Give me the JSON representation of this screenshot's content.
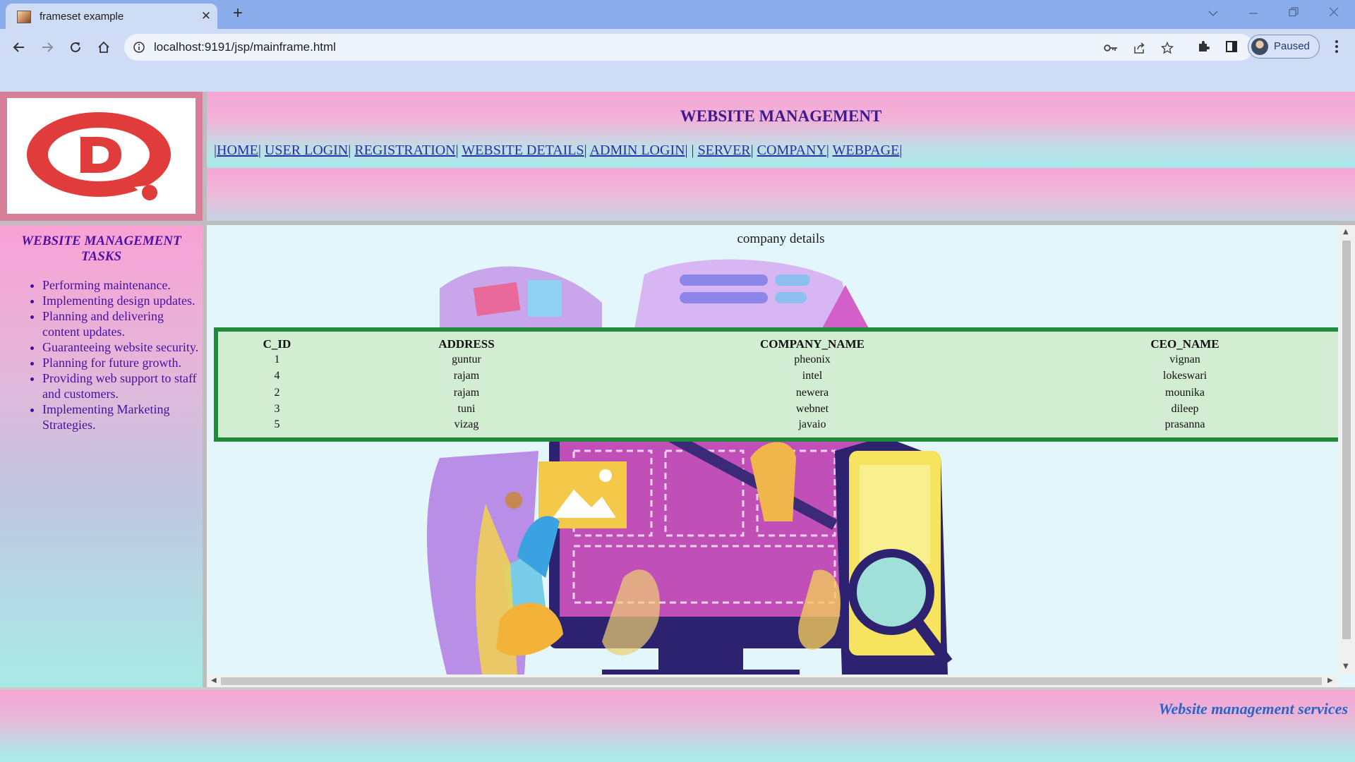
{
  "browser": {
    "tab_title": "frameset example",
    "new_tab_symbol": "+",
    "close_symbol": "✕",
    "url": "localhost:9191/jsp/mainframe.html",
    "profile_label": "Paused",
    "icons": [
      "back-icon",
      "forward-icon",
      "reload-icon",
      "home-icon",
      "site-info-icon",
      "key-icon",
      "share-icon",
      "star-icon",
      "extensions-icon",
      "side-panel-icon",
      "avatar",
      "menu-icon"
    ]
  },
  "header": {
    "title": "WEBSITE MANAGEMENT",
    "menu": [
      {
        "label": "HOME"
      },
      {
        "label": "USER LOGIN"
      },
      {
        "label": "REGISTRATION"
      },
      {
        "label": "WEBSITE DETAILS"
      },
      {
        "label": "ADMIN LOGIN"
      },
      {
        "label": "SERVER"
      },
      {
        "label": "COMPANY"
      },
      {
        "label": "WEBPAGE"
      }
    ]
  },
  "sidebar": {
    "title": "WEBSITE MANAGEMENT TASKS",
    "tasks": [
      "Performing maintenance.",
      "Implementing design updates.",
      "Planning and delivering content updates.",
      "Guaranteeing website security.",
      "Planning for future growth.",
      "Providing web support to staff and customers.",
      "Implementing Marketing Strategies."
    ]
  },
  "main": {
    "heading": "company details",
    "table": {
      "columns": [
        "C_ID",
        "ADDRESS",
        "COMPANY_NAME",
        "CEO_NAME"
      ],
      "rows": [
        [
          "1",
          "guntur",
          "pheonix",
          "vignan"
        ],
        [
          "4",
          "rajam",
          "intel",
          "lokeswari"
        ],
        [
          "2",
          "rajam",
          "newera",
          "mounika"
        ],
        [
          "3",
          "tuni",
          "webnet",
          "dileep"
        ],
        [
          "5",
          "vizag",
          "javaio",
          "prasanna"
        ]
      ]
    }
  },
  "footer": {
    "text": "Website management services"
  },
  "colors": {
    "title": "#3f1a8f",
    "link": "#2d2ea3",
    "table_border": "#1f8a3a",
    "table_bg": "#d2edd1",
    "footer_text": "#2a63c9",
    "logo_red": "#e03c3c"
  }
}
